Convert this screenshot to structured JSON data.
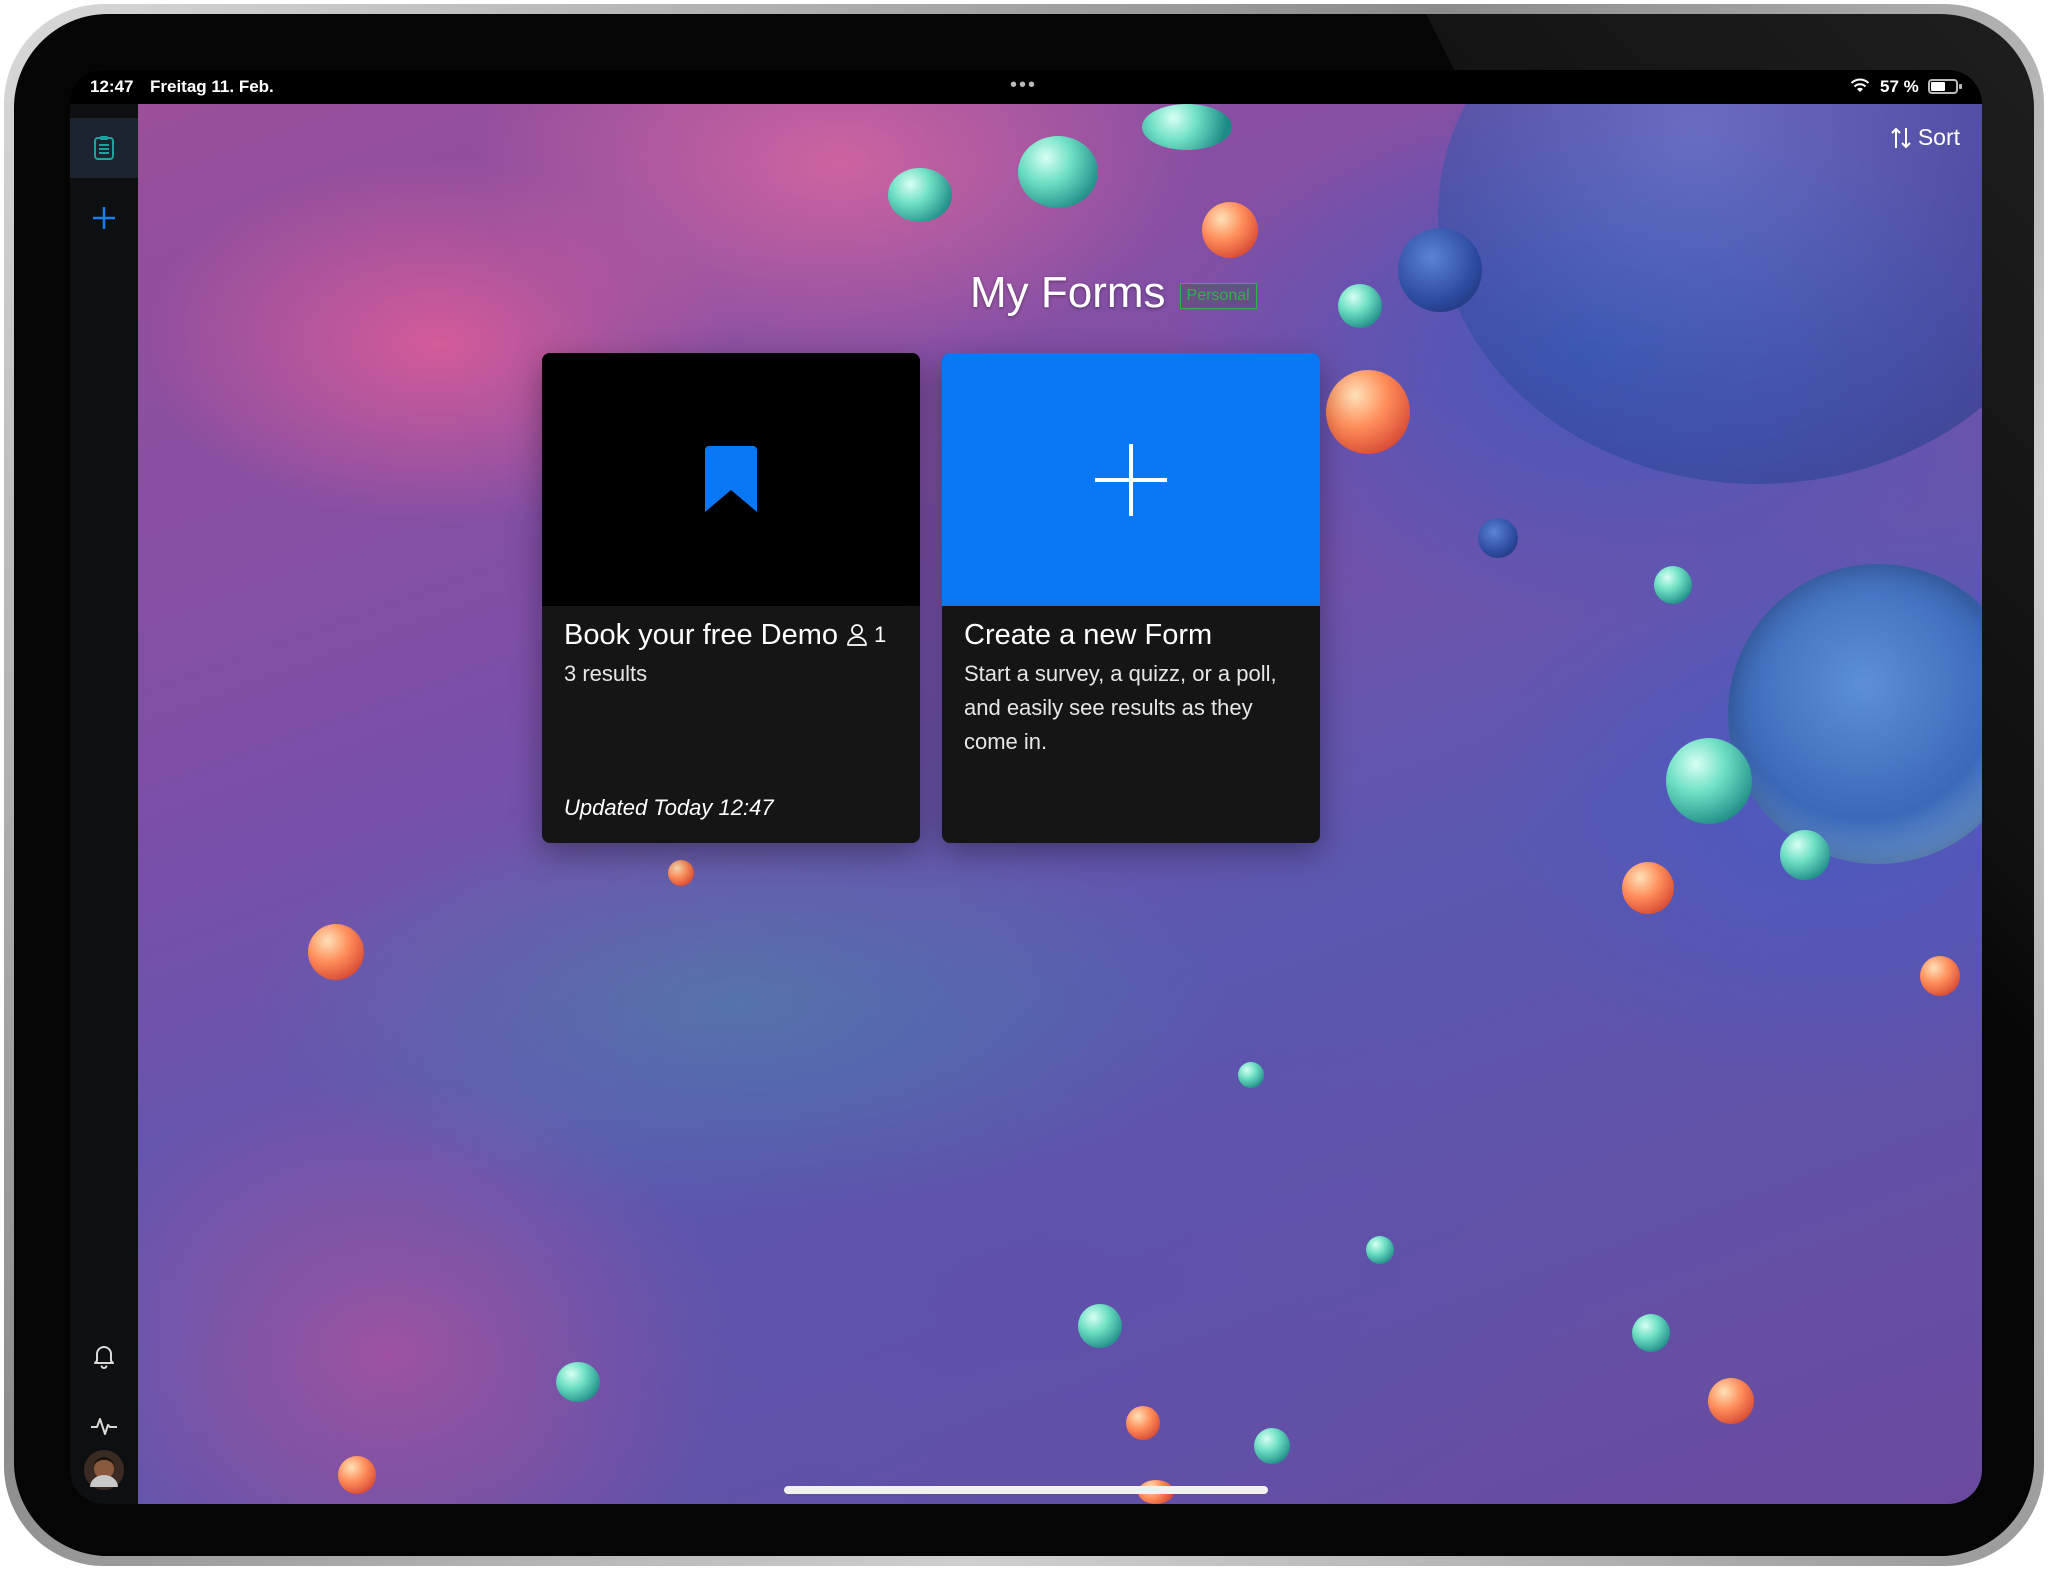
{
  "status_bar": {
    "time": "12:47",
    "date": "Freitag 11. Feb.",
    "battery_percent": "57 %",
    "battery_level": 0.57
  },
  "sidebar": {
    "items": [
      {
        "icon": "clipboard-list-icon",
        "active": true
      },
      {
        "icon": "plus-icon"
      },
      {
        "icon": "bell-icon"
      },
      {
        "icon": "activity-icon"
      },
      {
        "icon": "avatar"
      }
    ]
  },
  "toolbar": {
    "sort_label": "Sort",
    "sort_icon": "sort-arrows-icon"
  },
  "header": {
    "title": "My Forms",
    "badge": "Personal"
  },
  "cards": [
    {
      "title": "Book your free Demo",
      "shared_count": "1",
      "results": "3 results",
      "updated": "Updated Today 12:47",
      "icon": "bookmark-icon",
      "banner_color": "#000000"
    },
    {
      "title": "Create a new Form",
      "description": "Start a survey, a quizz, or a poll, and easily see results as they come in.",
      "icon": "plus-icon",
      "banner_color": "#0a78f5"
    }
  ],
  "colors": {
    "accent": "#0a78f5",
    "card_bg": "#151515",
    "badge": "#2fb34a"
  }
}
